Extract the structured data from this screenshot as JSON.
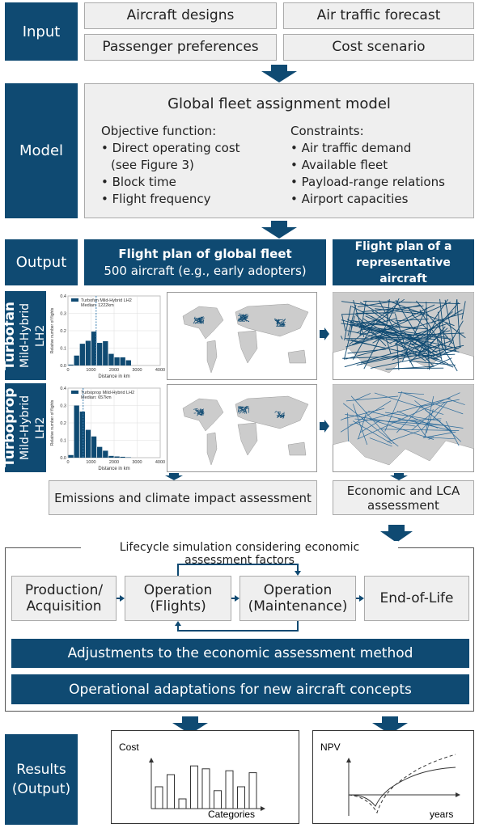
{
  "input": {
    "label": "Input",
    "items": [
      "Aircraft designs",
      "Air traffic forecast",
      "Passenger preferences",
      "Cost scenario"
    ]
  },
  "model": {
    "label": "Model",
    "title": "Global fleet assignment model",
    "objective": {
      "heading": "Objective function:",
      "items": [
        "Direct operating cost",
        "(see Figure 3)",
        "Block time",
        "Flight frequency"
      ]
    },
    "constraints": {
      "heading": "Constraints:",
      "items": [
        "Air traffic demand",
        "Available fleet",
        "Payload-range relations",
        "Airport capacities"
      ]
    }
  },
  "output": {
    "label": "Output",
    "global": {
      "title": "Flight plan of global fleet",
      "subtitle": "500 aircraft (e.g., early adopters)"
    },
    "representative": {
      "title": "Flight plan of a representative aircraft"
    }
  },
  "rows": [
    {
      "name": "Turbofan",
      "sub": "Mild-Hybrid LH2"
    },
    {
      "name": "Turboprop",
      "sub": "Mild-Hybrid LH2"
    }
  ],
  "chart_data": [
    {
      "type": "bar",
      "xlabel": "Distance in km",
      "ylabel": "Relative number of flights",
      "xlim": [
        0,
        4000
      ],
      "ylim": [
        0,
        0.4
      ],
      "xticks": [
        "0",
        "1000",
        "2000",
        "3000",
        "4000"
      ],
      "yticks": [
        "0.0",
        "0.1",
        "0.2",
        "0.3",
        "0.4"
      ],
      "grid": true,
      "legend": "top",
      "series": [
        {
          "name": "Turbofan Mild-Hybrid LH2",
          "bin_width": 250,
          "x": [
            0,
            250,
            500,
            750,
            1000,
            1250,
            1500,
            1750,
            2000,
            2250,
            2500
          ],
          "values": [
            0.005,
            0.057,
            0.125,
            0.142,
            0.195,
            0.13,
            0.14,
            0.067,
            0.047,
            0.047,
            0.03
          ]
        }
      ],
      "median_label": "Median: 1222km",
      "median": 1222
    },
    {
      "type": "bar",
      "xlabel": "Distance in km",
      "ylabel": "Relative number of flights",
      "xlim": [
        0,
        4000
      ],
      "ylim": [
        0,
        0.4
      ],
      "xticks": [
        "0",
        "1000",
        "2000",
        "3000",
        "4000"
      ],
      "yticks": [
        "0.0",
        "0.1",
        "0.2",
        "0.3",
        "0.4"
      ],
      "grid": true,
      "legend": "top",
      "series": [
        {
          "name": "Turboprop Mild-Hybrid LH2",
          "bin_width": 250,
          "x": [
            0,
            250,
            500,
            750,
            1000,
            1250,
            1500,
            1750,
            2000,
            2250,
            2500
          ],
          "values": [
            0.015,
            0.3,
            0.265,
            0.16,
            0.122,
            0.062,
            0.04,
            0.01,
            0.007,
            0.005,
            0.002
          ]
        }
      ],
      "median_label": "Median: 657km",
      "median": 657
    }
  ],
  "assessments": {
    "emissions": "Emissions and climate impact assessment",
    "economic": "Economic and LCA assessment"
  },
  "lifecycle": {
    "title": "Lifecycle simulation considering economic assessment factors",
    "steps": [
      "Production/ Acquisition",
      "Operation (Flights)",
      "Operation (Maintenance)",
      "End-of-Life"
    ],
    "bars": [
      "Adjustments to the economic assessment method",
      "Operational adaptations for new aircraft concepts"
    ]
  },
  "results": {
    "label": "Results (Output)",
    "cost_chart": {
      "ylabel": "Cost",
      "xlabel": "Categories",
      "values": [
        0.45,
        0.7,
        0.2,
        0.88,
        0.82,
        0.37,
        0.78,
        0.45,
        0.74
      ]
    },
    "npv_chart": {
      "ylabel": "NPV",
      "xlabel": "years"
    }
  },
  "colors": {
    "accent": "#0f4a72",
    "box": "#efefef"
  }
}
